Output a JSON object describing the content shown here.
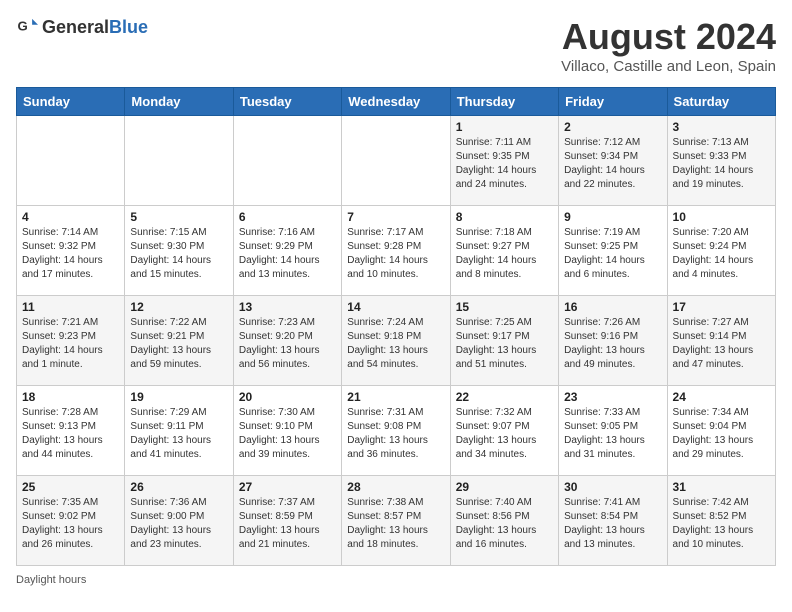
{
  "header": {
    "logo_general": "General",
    "logo_blue": "Blue",
    "main_title": "August 2024",
    "subtitle": "Villaco, Castille and Leon, Spain"
  },
  "days_of_week": [
    "Sunday",
    "Monday",
    "Tuesday",
    "Wednesday",
    "Thursday",
    "Friday",
    "Saturday"
  ],
  "weeks": [
    [
      {
        "day": "",
        "detail": ""
      },
      {
        "day": "",
        "detail": ""
      },
      {
        "day": "",
        "detail": ""
      },
      {
        "day": "",
        "detail": ""
      },
      {
        "day": "1",
        "detail": "Sunrise: 7:11 AM\nSunset: 9:35 PM\nDaylight: 14 hours and 24 minutes."
      },
      {
        "day": "2",
        "detail": "Sunrise: 7:12 AM\nSunset: 9:34 PM\nDaylight: 14 hours and 22 minutes."
      },
      {
        "day": "3",
        "detail": "Sunrise: 7:13 AM\nSunset: 9:33 PM\nDaylight: 14 hours and 19 minutes."
      }
    ],
    [
      {
        "day": "4",
        "detail": "Sunrise: 7:14 AM\nSunset: 9:32 PM\nDaylight: 14 hours and 17 minutes."
      },
      {
        "day": "5",
        "detail": "Sunrise: 7:15 AM\nSunset: 9:30 PM\nDaylight: 14 hours and 15 minutes."
      },
      {
        "day": "6",
        "detail": "Sunrise: 7:16 AM\nSunset: 9:29 PM\nDaylight: 14 hours and 13 minutes."
      },
      {
        "day": "7",
        "detail": "Sunrise: 7:17 AM\nSunset: 9:28 PM\nDaylight: 14 hours and 10 minutes."
      },
      {
        "day": "8",
        "detail": "Sunrise: 7:18 AM\nSunset: 9:27 PM\nDaylight: 14 hours and 8 minutes."
      },
      {
        "day": "9",
        "detail": "Sunrise: 7:19 AM\nSunset: 9:25 PM\nDaylight: 14 hours and 6 minutes."
      },
      {
        "day": "10",
        "detail": "Sunrise: 7:20 AM\nSunset: 9:24 PM\nDaylight: 14 hours and 4 minutes."
      }
    ],
    [
      {
        "day": "11",
        "detail": "Sunrise: 7:21 AM\nSunset: 9:23 PM\nDaylight: 14 hours and 1 minute."
      },
      {
        "day": "12",
        "detail": "Sunrise: 7:22 AM\nSunset: 9:21 PM\nDaylight: 13 hours and 59 minutes."
      },
      {
        "day": "13",
        "detail": "Sunrise: 7:23 AM\nSunset: 9:20 PM\nDaylight: 13 hours and 56 minutes."
      },
      {
        "day": "14",
        "detail": "Sunrise: 7:24 AM\nSunset: 9:18 PM\nDaylight: 13 hours and 54 minutes."
      },
      {
        "day": "15",
        "detail": "Sunrise: 7:25 AM\nSunset: 9:17 PM\nDaylight: 13 hours and 51 minutes."
      },
      {
        "day": "16",
        "detail": "Sunrise: 7:26 AM\nSunset: 9:16 PM\nDaylight: 13 hours and 49 minutes."
      },
      {
        "day": "17",
        "detail": "Sunrise: 7:27 AM\nSunset: 9:14 PM\nDaylight: 13 hours and 47 minutes."
      }
    ],
    [
      {
        "day": "18",
        "detail": "Sunrise: 7:28 AM\nSunset: 9:13 PM\nDaylight: 13 hours and 44 minutes."
      },
      {
        "day": "19",
        "detail": "Sunrise: 7:29 AM\nSunset: 9:11 PM\nDaylight: 13 hours and 41 minutes."
      },
      {
        "day": "20",
        "detail": "Sunrise: 7:30 AM\nSunset: 9:10 PM\nDaylight: 13 hours and 39 minutes."
      },
      {
        "day": "21",
        "detail": "Sunrise: 7:31 AM\nSunset: 9:08 PM\nDaylight: 13 hours and 36 minutes."
      },
      {
        "day": "22",
        "detail": "Sunrise: 7:32 AM\nSunset: 9:07 PM\nDaylight: 13 hours and 34 minutes."
      },
      {
        "day": "23",
        "detail": "Sunrise: 7:33 AM\nSunset: 9:05 PM\nDaylight: 13 hours and 31 minutes."
      },
      {
        "day": "24",
        "detail": "Sunrise: 7:34 AM\nSunset: 9:04 PM\nDaylight: 13 hours and 29 minutes."
      }
    ],
    [
      {
        "day": "25",
        "detail": "Sunrise: 7:35 AM\nSunset: 9:02 PM\nDaylight: 13 hours and 26 minutes."
      },
      {
        "day": "26",
        "detail": "Sunrise: 7:36 AM\nSunset: 9:00 PM\nDaylight: 13 hours and 23 minutes."
      },
      {
        "day": "27",
        "detail": "Sunrise: 7:37 AM\nSunset: 8:59 PM\nDaylight: 13 hours and 21 minutes."
      },
      {
        "day": "28",
        "detail": "Sunrise: 7:38 AM\nSunset: 8:57 PM\nDaylight: 13 hours and 18 minutes."
      },
      {
        "day": "29",
        "detail": "Sunrise: 7:40 AM\nSunset: 8:56 PM\nDaylight: 13 hours and 16 minutes."
      },
      {
        "day": "30",
        "detail": "Sunrise: 7:41 AM\nSunset: 8:54 PM\nDaylight: 13 hours and 13 minutes."
      },
      {
        "day": "31",
        "detail": "Sunrise: 7:42 AM\nSunset: 8:52 PM\nDaylight: 13 hours and 10 minutes."
      }
    ]
  ],
  "footer": {
    "label": "Daylight hours"
  }
}
